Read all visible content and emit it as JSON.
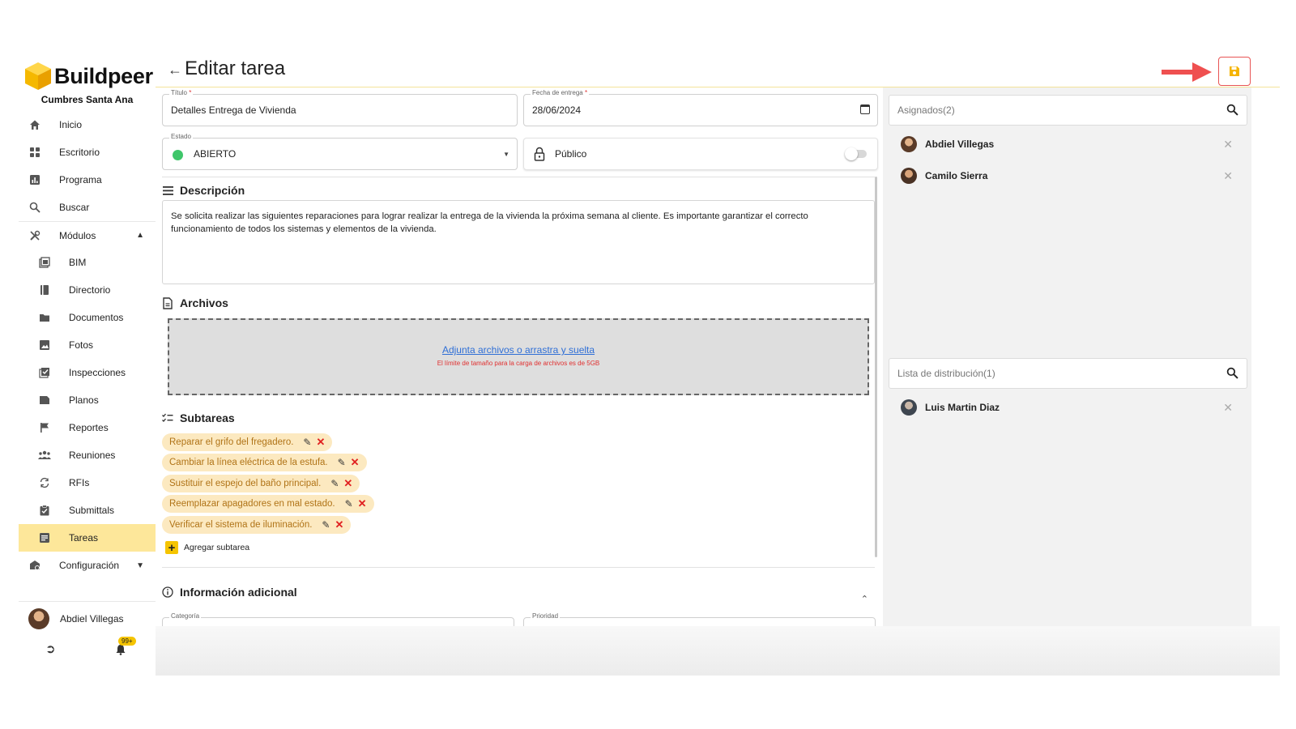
{
  "app": {
    "brand": "Buildpeer",
    "organization": "Cumbres Santa Ana",
    "accent": "#f5c400"
  },
  "sidebar": {
    "items": [
      {
        "label": "Inicio",
        "icon": "home-icon"
      },
      {
        "label": "Escritorio",
        "icon": "grid-icon"
      },
      {
        "label": "Programa",
        "icon": "chart-icon"
      },
      {
        "label": "Buscar",
        "icon": "search-icon"
      },
      {
        "label": "Módulos",
        "icon": "tools-icon"
      },
      {
        "label": "BIM",
        "icon": "bim-icon"
      },
      {
        "label": "Directorio",
        "icon": "book-icon"
      },
      {
        "label": "Documentos",
        "icon": "folder-icon"
      },
      {
        "label": "Fotos",
        "icon": "image-icon"
      },
      {
        "label": "Inspecciones",
        "icon": "checklist-icon"
      },
      {
        "label": "Planos",
        "icon": "plans-icon"
      },
      {
        "label": "Reportes",
        "icon": "flag-icon"
      },
      {
        "label": "Reuniones",
        "icon": "people-icon"
      },
      {
        "label": "RFIs",
        "icon": "sync-icon"
      },
      {
        "label": "Submittals",
        "icon": "clipboard-check-icon"
      },
      {
        "label": "Tareas",
        "icon": "task-icon"
      },
      {
        "label": "Configuración",
        "icon": "settings-icon"
      }
    ],
    "user_name": "Abdiel Villegas",
    "notifications_badge": "99+"
  },
  "header": {
    "title": "Editar tarea"
  },
  "form": {
    "title_label": "Título",
    "title_value": "Detalles Entrega de Vivienda",
    "date_label": "Fecha de entrega",
    "date_value": "28/06/2024",
    "state_label": "Estado",
    "state_value": "ABIERTO",
    "state_color": "#3fc66a",
    "visibility_label": "Público",
    "public_toggle_on": false
  },
  "description": {
    "heading": "Descripción",
    "text": "Se solicita realizar las siguientes reparaciones para lograr realizar la entrega de la vivienda la próxima semana al cliente. Es importante garantizar el correcto funcionamiento de todos los sistemas y elementos de la vivienda."
  },
  "files": {
    "heading": "Archivos",
    "upload_link": "Adjunta archivos o arrastra y suelta",
    "size_note": "El límite de tamaño para la carga de archivos es de 5GB"
  },
  "subtasks": {
    "heading": "Subtareas",
    "items": [
      "Reparar el grifo del fregadero.",
      "Cambiar la línea eléctrica de la estufa.",
      "Sustituir el espejo del baño principal.",
      "Reemplazar apagadores en mal estado.",
      "Verificar el sistema de iluminación."
    ],
    "add_label": "Agregar subtarea"
  },
  "additional": {
    "heading": "Información adicional",
    "category_label": "Categoría",
    "priority_label": "Prioridad"
  },
  "assigned": {
    "placeholder": "Asignados(2)",
    "people": [
      "Abdiel Villegas",
      "Camilo Sierra"
    ]
  },
  "distribution": {
    "placeholder": "Lista de distribución(1)",
    "people": [
      "Luis Martin Diaz"
    ]
  }
}
